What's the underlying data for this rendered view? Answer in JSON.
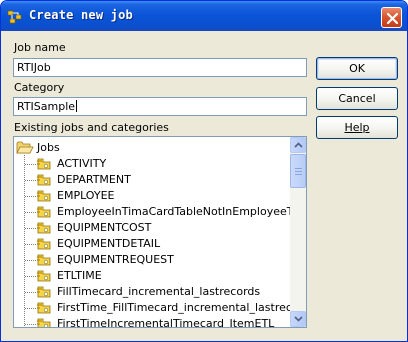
{
  "window": {
    "title": "Create new job",
    "accent": "#0a55d8",
    "icons": {
      "app": "app-icon",
      "close": "close-icon"
    }
  },
  "form": {
    "job_name_label": "Job name",
    "job_name_value": "RTIJob",
    "category_label": "Category",
    "category_value": "RTISample",
    "tree_label": "Existing jobs and categories"
  },
  "buttons": {
    "ok": "OK",
    "cancel": "Cancel",
    "help": "Help"
  },
  "tree": {
    "root": {
      "label": "Jobs",
      "icon": "folder-open-icon"
    },
    "items": [
      {
        "label": "ACTIVITY",
        "icon": "job-icon"
      },
      {
        "label": "DEPARTMENT",
        "icon": "job-icon"
      },
      {
        "label": "EMPLOYEE",
        "icon": "job-icon"
      },
      {
        "label": "EmployeeInTimaCardTableNotInEmployeeTable",
        "icon": "job-icon"
      },
      {
        "label": "EQUIPMENTCOST",
        "icon": "job-icon"
      },
      {
        "label": "EQUIPMENTDETAIL",
        "icon": "job-icon"
      },
      {
        "label": "EQUIPMENTREQUEST",
        "icon": "job-icon"
      },
      {
        "label": "ETLTIME",
        "icon": "job-icon"
      },
      {
        "label": "FillTimecard_incremental_lastrecords",
        "icon": "job-icon"
      },
      {
        "label": "FirstTime_FillTimecard_incremental_lastrecords",
        "icon": "job-icon"
      },
      {
        "label": "FirstTimeIncrementalTimecard_ItemETL",
        "icon": "job-icon"
      }
    ]
  }
}
